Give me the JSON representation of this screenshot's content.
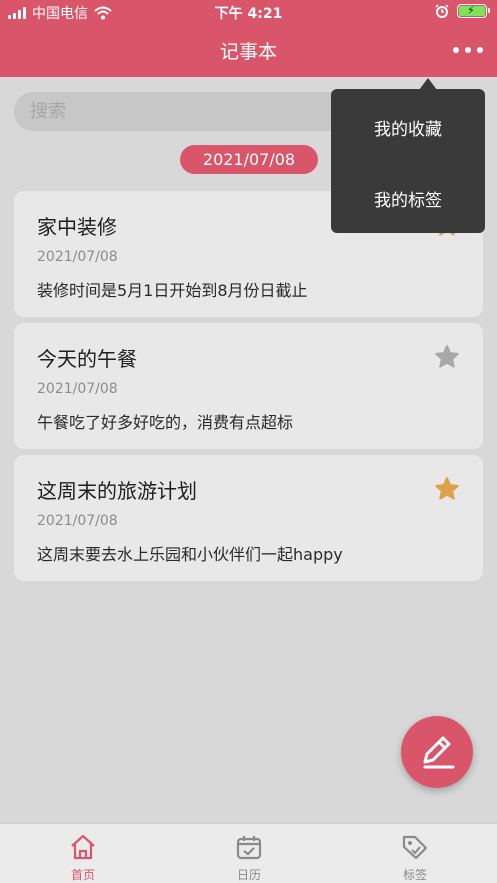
{
  "status_bar": {
    "carrier": "中国电信",
    "time": "下午 4:21"
  },
  "navbar": {
    "title": "记事本",
    "more_icon": "more-dots-icon"
  },
  "search": {
    "placeholder": "搜索"
  },
  "date_group": "2021/07/08",
  "notes": [
    {
      "title": "家中装修",
      "date": "2021/07/08",
      "content": "装修时间是5月1日开始到8月份日截止",
      "favorited": true
    },
    {
      "title": "今天的午餐",
      "date": "2021/07/08",
      "content": "午餐吃了好多好吃的，消费有点超标",
      "favorited": false
    },
    {
      "title": "这周末的旅游计划",
      "date": "2021/07/08",
      "content": "这周末要去水上乐园和小伙伴们一起happy",
      "favorited": true
    }
  ],
  "dropdown_menu": {
    "items": [
      "我的收藏",
      "我的标签"
    ]
  },
  "fab": {
    "icon": "edit-pencil-icon"
  },
  "tabbar": {
    "tabs": [
      {
        "label": "首页",
        "icon": "home-icon",
        "active": true
      },
      {
        "label": "日历",
        "icon": "calendar-icon",
        "active": false
      },
      {
        "label": "标签",
        "icon": "tag-icon",
        "active": false
      }
    ]
  },
  "colors": {
    "accent": "#d9566a",
    "star_active": "#dfa04a",
    "star_inactive": "#a8a8a8",
    "menu_bg": "#3a3a3a"
  }
}
